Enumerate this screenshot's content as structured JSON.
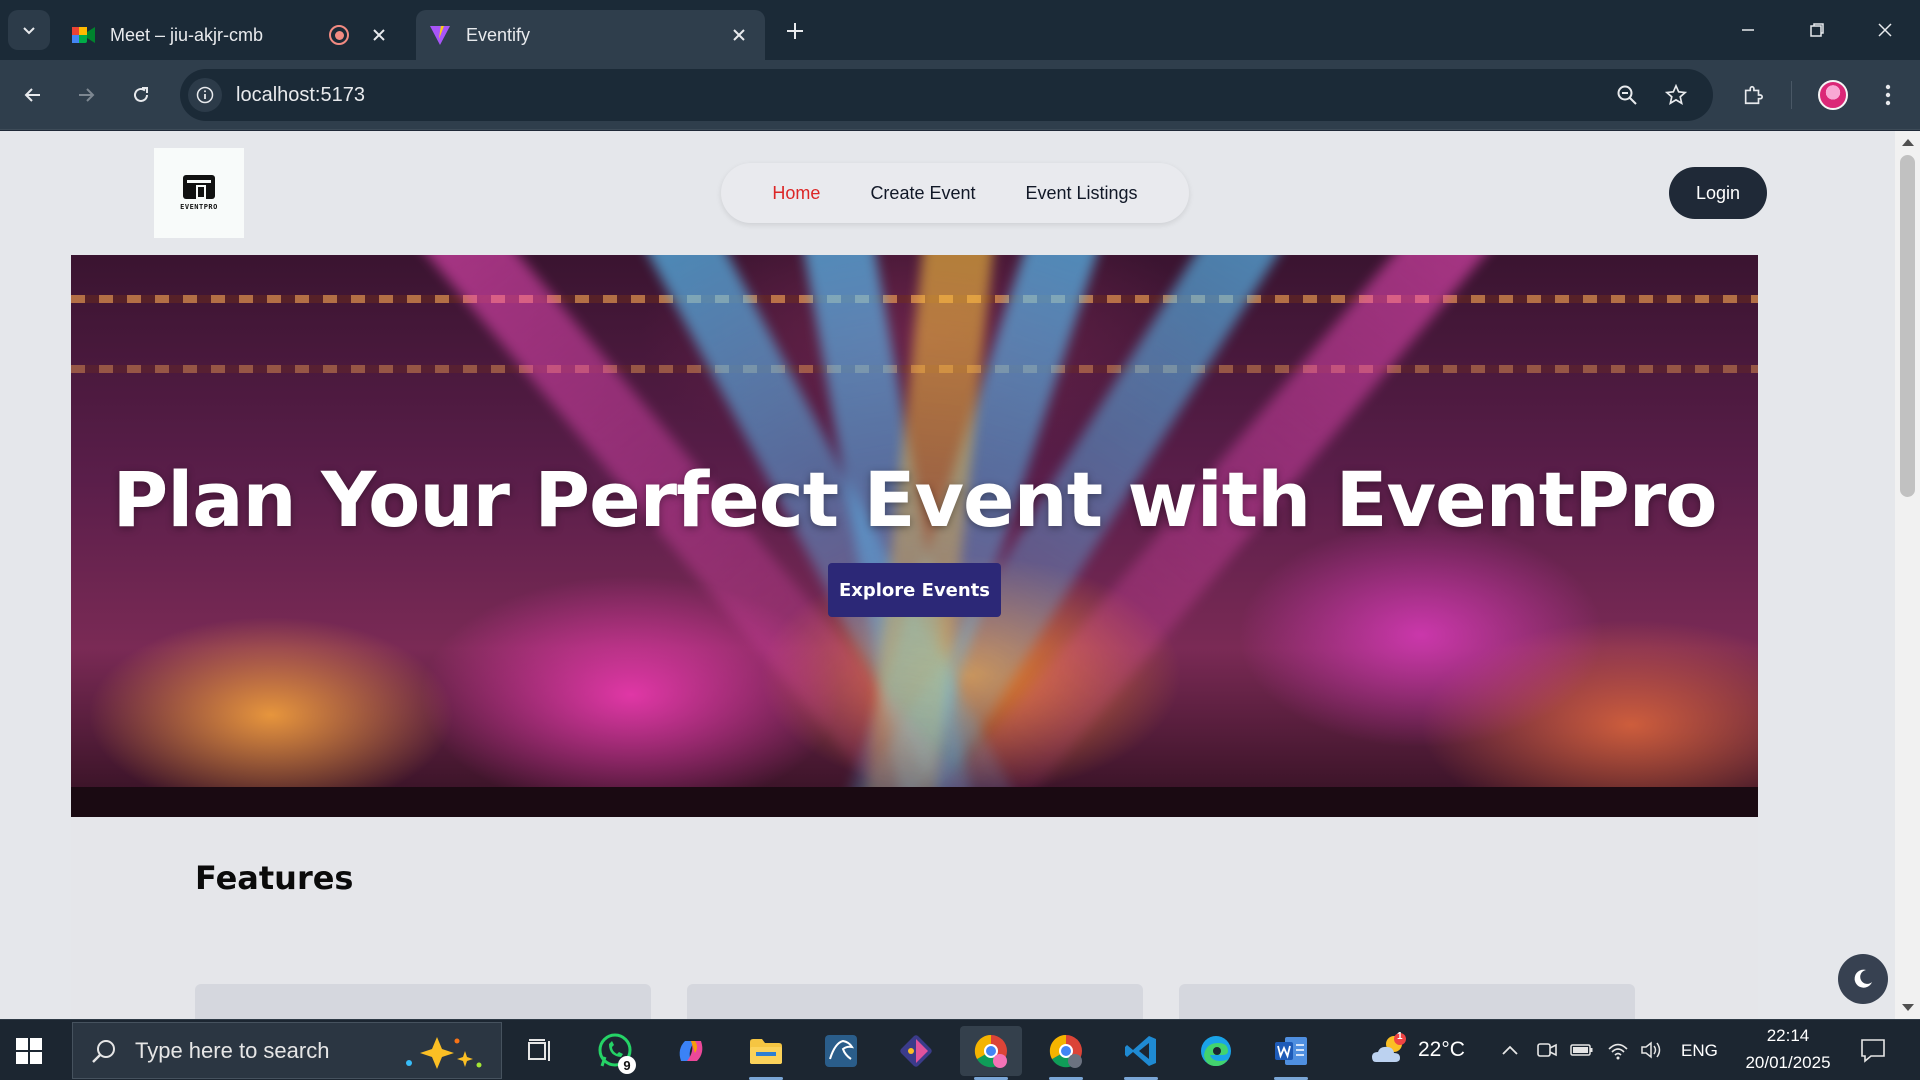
{
  "browser": {
    "tabs": [
      {
        "title": "Meet – jiu-akjr-cmb",
        "favicon": "google-meet-icon",
        "recording": true,
        "active": false
      },
      {
        "title": "Eventify",
        "favicon": "vite-icon",
        "recording": false,
        "active": true
      }
    ],
    "url": "localhost:5173"
  },
  "page": {
    "logo_text": "EVENTPRO",
    "nav": [
      {
        "label": "Home",
        "current": true
      },
      {
        "label": "Create Event",
        "current": false
      },
      {
        "label": "Event Listings",
        "current": false
      }
    ],
    "login_label": "Login",
    "hero": {
      "headline": "Plan Your Perfect Event with EventPro",
      "cta_label": "Explore Events"
    },
    "features_heading": "Features"
  },
  "taskbar": {
    "search_placeholder": "Type here to search",
    "whatsapp_badge": "9",
    "weather_badge": "1",
    "temperature": "22°C",
    "language": "ENG",
    "time": "22:14",
    "date": "20/01/2025"
  },
  "colors": {
    "nav_active": "#dc2626",
    "login_bg": "#1f2937",
    "cta_bg": "#2c2877",
    "page_bg": "#e5e7eb",
    "chrome_bg": "#1b2a37"
  }
}
